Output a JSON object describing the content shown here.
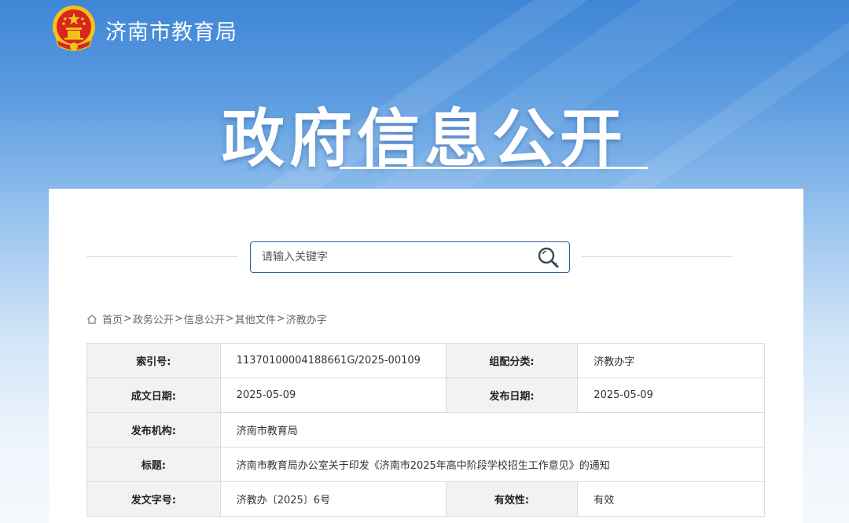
{
  "header": {
    "agency_name": "济南市教育局"
  },
  "hero": {
    "title": "政府信息公开"
  },
  "search": {
    "placeholder": "请输入关键字"
  },
  "breadcrumb": {
    "items": [
      "首页",
      "政务公开",
      "信息公开",
      "其他文件",
      "济教办字"
    ],
    "separator": ">"
  },
  "info_table": {
    "index_label": "索引号:",
    "index_value": "11370100004188661G/2025-00109",
    "category_label": "组配分类:",
    "category_value": "济教办字",
    "created_label": "成文日期:",
    "created_value": "2025-05-09",
    "published_label": "发布日期:",
    "published_value": "2025-05-09",
    "issuer_label": "发布机构:",
    "issuer_value": "济南市教育局",
    "title_label": "标题:",
    "title_value": "济南市教育局办公室关于印发《济南市2025年高中阶段学校招生工作意见》的通知",
    "doc_no_label": "发文字号:",
    "doc_no_value": "济教办〔2025〕6号",
    "validity_label": "有效性:",
    "validity_value": "有效"
  },
  "colors": {
    "accent": "#2f5f9c",
    "header_blue": "#3f86d6",
    "emblem_red": "#d7261e",
    "emblem_gold": "#f3c21a"
  },
  "icons": {
    "emblem": "national-emblem-icon",
    "search": "search-icon",
    "home": "home-icon"
  }
}
